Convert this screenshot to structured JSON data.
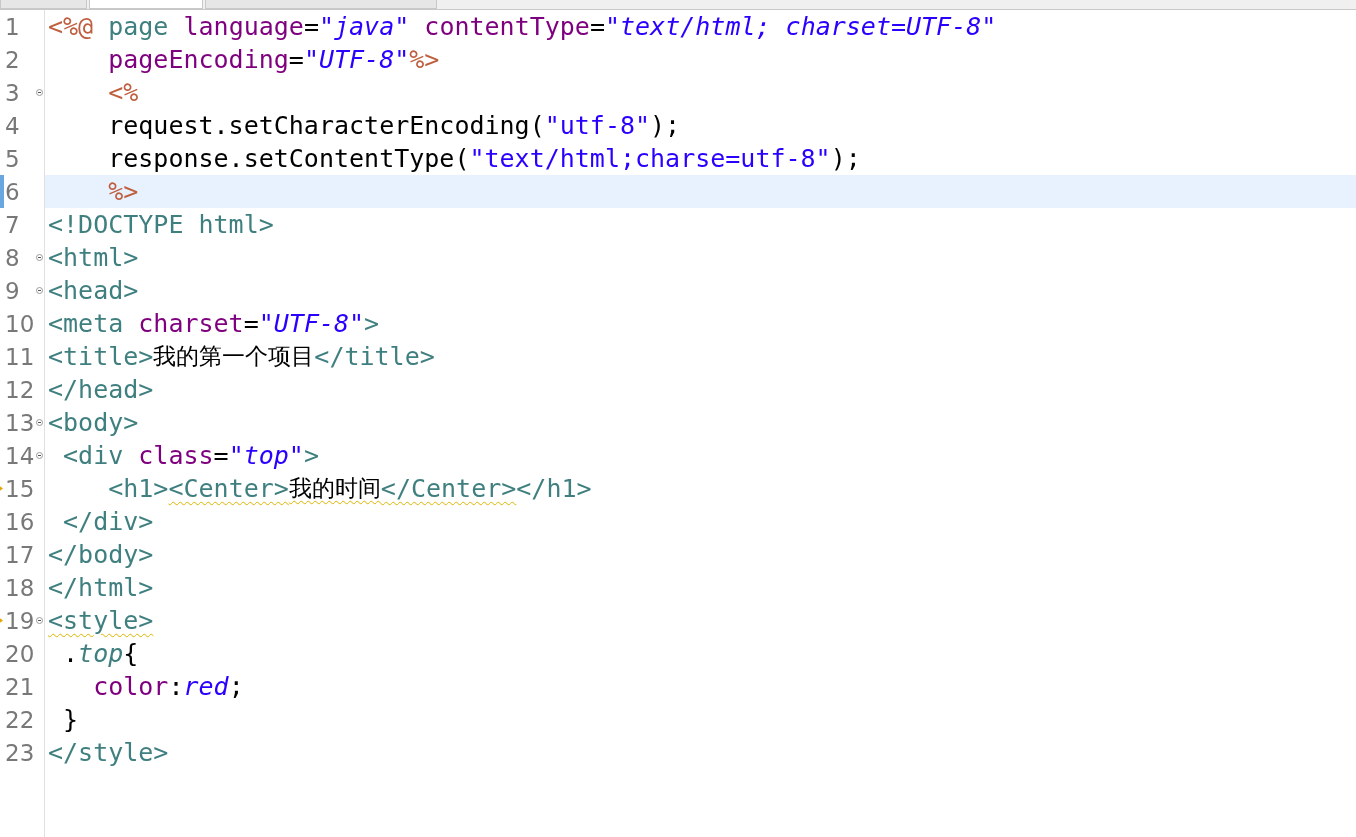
{
  "editor": {
    "lines": [
      {
        "number": "1",
        "foldable": false,
        "warning": false,
        "current": false,
        "tokens": [
          {
            "kind": "delim",
            "text": "<%@ "
          },
          {
            "kind": "keyword",
            "text": "page "
          },
          {
            "kind": "attr",
            "text": "language"
          },
          {
            "kind": "plain",
            "text": "="
          },
          {
            "kind": "value",
            "text": "\"java\" "
          },
          {
            "kind": "attr",
            "text": "contentType"
          },
          {
            "kind": "plain",
            "text": "="
          },
          {
            "kind": "value",
            "text": "\"text/html; charset=UTF-8\""
          }
        ]
      },
      {
        "number": "2",
        "foldable": false,
        "warning": false,
        "current": false,
        "tokens": [
          {
            "kind": "attr",
            "text": "    pageEncoding"
          },
          {
            "kind": "plain",
            "text": "="
          },
          {
            "kind": "value",
            "text": "\"UTF-8\""
          },
          {
            "kind": "delim",
            "text": "%>"
          }
        ]
      },
      {
        "number": "3",
        "foldable": true,
        "warning": false,
        "current": false,
        "tokens": [
          {
            "kind": "delim",
            "text": "    <%"
          }
        ]
      },
      {
        "number": "4",
        "foldable": false,
        "warning": false,
        "current": false,
        "tokens": [
          {
            "kind": "plain",
            "text": "    request.setCharacterEncoding("
          },
          {
            "kind": "string",
            "text": "\"utf-8\""
          },
          {
            "kind": "plain",
            "text": ");"
          }
        ]
      },
      {
        "number": "5",
        "foldable": false,
        "warning": false,
        "current": false,
        "tokens": [
          {
            "kind": "plain",
            "text": "    response.setContentType("
          },
          {
            "kind": "string",
            "text": "\"text/html;charse=utf-8\""
          },
          {
            "kind": "plain",
            "text": ");"
          }
        ]
      },
      {
        "number": "6",
        "foldable": false,
        "warning": false,
        "current": true,
        "tokens": [
          {
            "kind": "delim",
            "text": "    %>"
          }
        ]
      },
      {
        "number": "7",
        "foldable": false,
        "warning": false,
        "current": false,
        "tokens": [
          {
            "kind": "tag",
            "text": "<!DOCTYPE html>"
          }
        ]
      },
      {
        "number": "8",
        "foldable": true,
        "warning": false,
        "current": false,
        "tokens": [
          {
            "kind": "tag",
            "text": "<html>"
          }
        ]
      },
      {
        "number": "9",
        "foldable": true,
        "warning": false,
        "current": false,
        "tokens": [
          {
            "kind": "tag",
            "text": "<head>"
          }
        ]
      },
      {
        "number": "10",
        "foldable": false,
        "warning": false,
        "current": false,
        "tokens": [
          {
            "kind": "tag",
            "text": "<meta "
          },
          {
            "kind": "attr",
            "text": "charset"
          },
          {
            "kind": "plain",
            "text": "="
          },
          {
            "kind": "value",
            "text": "\"UTF-8\""
          },
          {
            "kind": "tag",
            "text": ">"
          }
        ]
      },
      {
        "number": "11",
        "foldable": false,
        "warning": false,
        "current": false,
        "tokens": [
          {
            "kind": "tag",
            "text": "<title>"
          },
          {
            "kind": "cjk",
            "text": "我的第一个项目"
          },
          {
            "kind": "tag",
            "text": "</title>"
          }
        ]
      },
      {
        "number": "12",
        "foldable": false,
        "warning": false,
        "current": false,
        "tokens": [
          {
            "kind": "tag",
            "text": "</head>"
          }
        ]
      },
      {
        "number": "13",
        "foldable": true,
        "warning": false,
        "current": false,
        "tokens": [
          {
            "kind": "tag",
            "text": "<body>"
          }
        ]
      },
      {
        "number": "14",
        "foldable": true,
        "warning": false,
        "current": false,
        "tokens": [
          {
            "kind": "tag",
            "text": " <div "
          },
          {
            "kind": "attr",
            "text": "class"
          },
          {
            "kind": "plain",
            "text": "="
          },
          {
            "kind": "value",
            "text": "\"top\""
          },
          {
            "kind": "tag",
            "text": ">"
          }
        ]
      },
      {
        "number": "15",
        "foldable": false,
        "warning": true,
        "current": false,
        "tokens": [
          {
            "kind": "tag",
            "text": "    <h1>"
          },
          {
            "kind": "tag",
            "text": "<Center>",
            "squiggle": true
          },
          {
            "kind": "cjk",
            "text": "我的时间",
            "squiggle": true
          },
          {
            "kind": "tag",
            "text": "</Center>",
            "squiggle": true
          },
          {
            "kind": "tag",
            "text": "</h1>"
          }
        ]
      },
      {
        "number": "16",
        "foldable": false,
        "warning": false,
        "current": false,
        "tokens": [
          {
            "kind": "tag",
            "text": " </div>"
          }
        ]
      },
      {
        "number": "17",
        "foldable": false,
        "warning": false,
        "current": false,
        "tokens": [
          {
            "kind": "tag",
            "text": "</body>"
          }
        ]
      },
      {
        "number": "18",
        "foldable": false,
        "warning": false,
        "current": false,
        "tokens": [
          {
            "kind": "tag",
            "text": "</html>"
          }
        ]
      },
      {
        "number": "19",
        "foldable": true,
        "warning": true,
        "current": false,
        "tokens": [
          {
            "kind": "tag",
            "text": "<style>",
            "squiggle": true
          }
        ]
      },
      {
        "number": "20",
        "foldable": false,
        "warning": false,
        "current": false,
        "tokens": [
          {
            "kind": "plain",
            "text": " ."
          },
          {
            "kind": "selector",
            "text": "top"
          },
          {
            "kind": "plain",
            "text": "{"
          }
        ]
      },
      {
        "number": "21",
        "foldable": false,
        "warning": false,
        "current": false,
        "tokens": [
          {
            "kind": "attr",
            "text": "   color"
          },
          {
            "kind": "plain",
            "text": ":"
          },
          {
            "kind": "value",
            "text": "red"
          },
          {
            "kind": "plain",
            "text": ";"
          }
        ]
      },
      {
        "number": "22",
        "foldable": false,
        "warning": false,
        "current": false,
        "tokens": [
          {
            "kind": "plain",
            "text": " }"
          }
        ]
      },
      {
        "number": "23",
        "foldable": false,
        "warning": false,
        "current": false,
        "tokens": [
          {
            "kind": "tag",
            "text": "</style>"
          }
        ]
      }
    ]
  }
}
